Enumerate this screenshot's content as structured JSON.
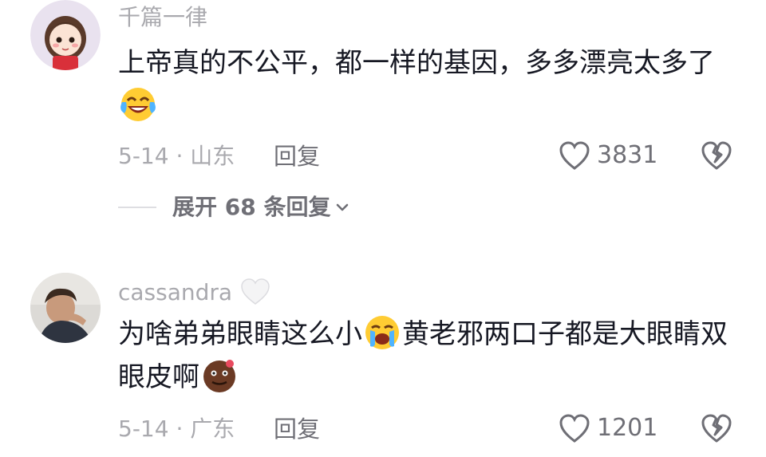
{
  "comments": [
    {
      "username": "千篇一律",
      "text_before_emoji": "上帝真的不公平，都一样的基因，多多漂亮太多了",
      "date_location": "5-14 · 山东",
      "reply_label": "回复",
      "likes": "3831",
      "expand_replies_label": "展开 68 条回复",
      "emoji": "laughing-crying-emoji"
    },
    {
      "username": "cassandra",
      "username_suffix_icon": "white-heart-icon",
      "text_part1": "为啥弟弟眼睛这么小",
      "text_part2": "黄老邪两口子都是大眼睛双眼皮啊",
      "date_location": "5-14 · 广东",
      "reply_label": "回复",
      "likes": "1201",
      "emoji1": "crying-emoji",
      "emoji2": "brown-face-emoji"
    }
  ],
  "colors": {
    "username": "#a9a9ae",
    "body_text": "#161823",
    "secondary": "#6f6f76"
  }
}
